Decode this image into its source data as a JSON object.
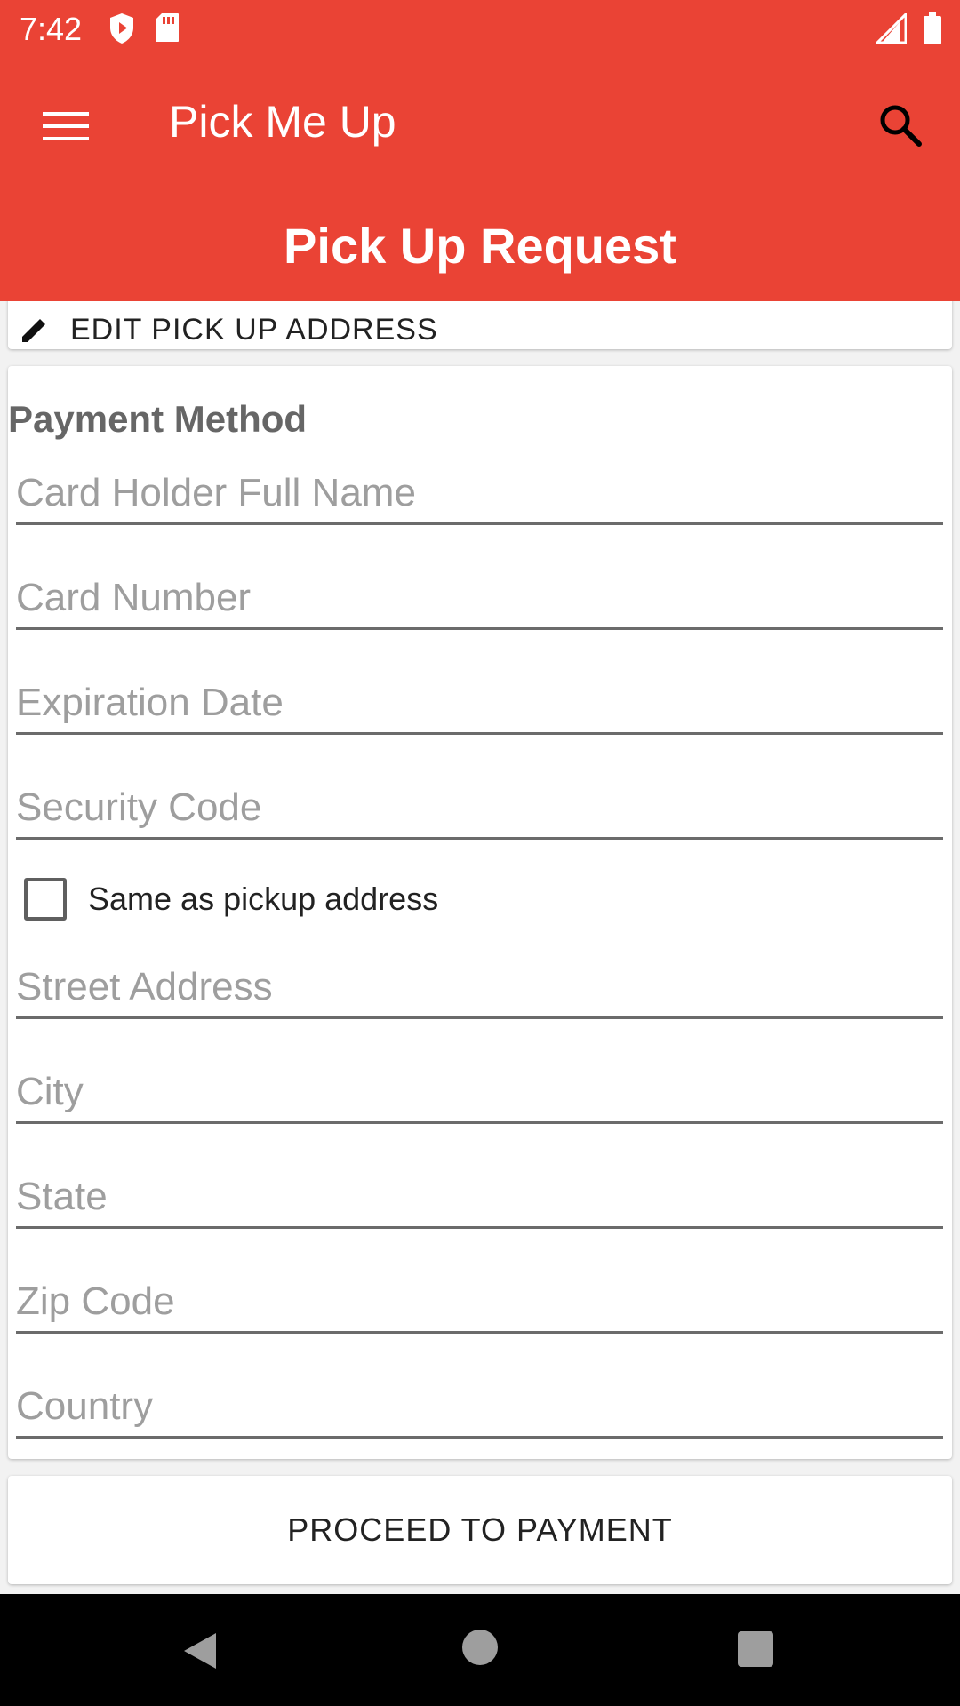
{
  "status_bar": {
    "time": "7:42",
    "left_icons": [
      "shield-play-icon",
      "sd-card-icon"
    ],
    "right_icons": [
      "signal-icon",
      "battery-icon"
    ]
  },
  "app_bar": {
    "title": "Pick Me Up",
    "page_title": "Pick Up Request",
    "menu_icon": "menu-icon",
    "search_icon": "search-icon",
    "color": "#ea4335"
  },
  "edit_card": {
    "label": "EDIT PICK UP ADDRESS",
    "icon": "edit-pencil-icon"
  },
  "payment": {
    "title": "Payment Method",
    "fields": {
      "card_holder": {
        "placeholder": "Card Holder Full Name",
        "value": ""
      },
      "card_number": {
        "placeholder": "Card Number",
        "value": ""
      },
      "expiration": {
        "placeholder": "Expiration Date",
        "value": ""
      },
      "security_code": {
        "placeholder": "Security Code",
        "value": ""
      },
      "street": {
        "placeholder": "Street Address",
        "value": ""
      },
      "city": {
        "placeholder": "City",
        "value": ""
      },
      "state": {
        "placeholder": "State",
        "value": ""
      },
      "zip": {
        "placeholder": "Zip Code",
        "value": ""
      },
      "country": {
        "placeholder": "Country",
        "value": ""
      }
    },
    "same_as_pickup": {
      "label": "Same as pickup address",
      "checked": false
    }
  },
  "proceed_button": {
    "label": "PROCEED TO PAYMENT"
  },
  "nav_bar": {
    "icons": [
      "back-icon",
      "home-icon",
      "recents-icon"
    ]
  }
}
